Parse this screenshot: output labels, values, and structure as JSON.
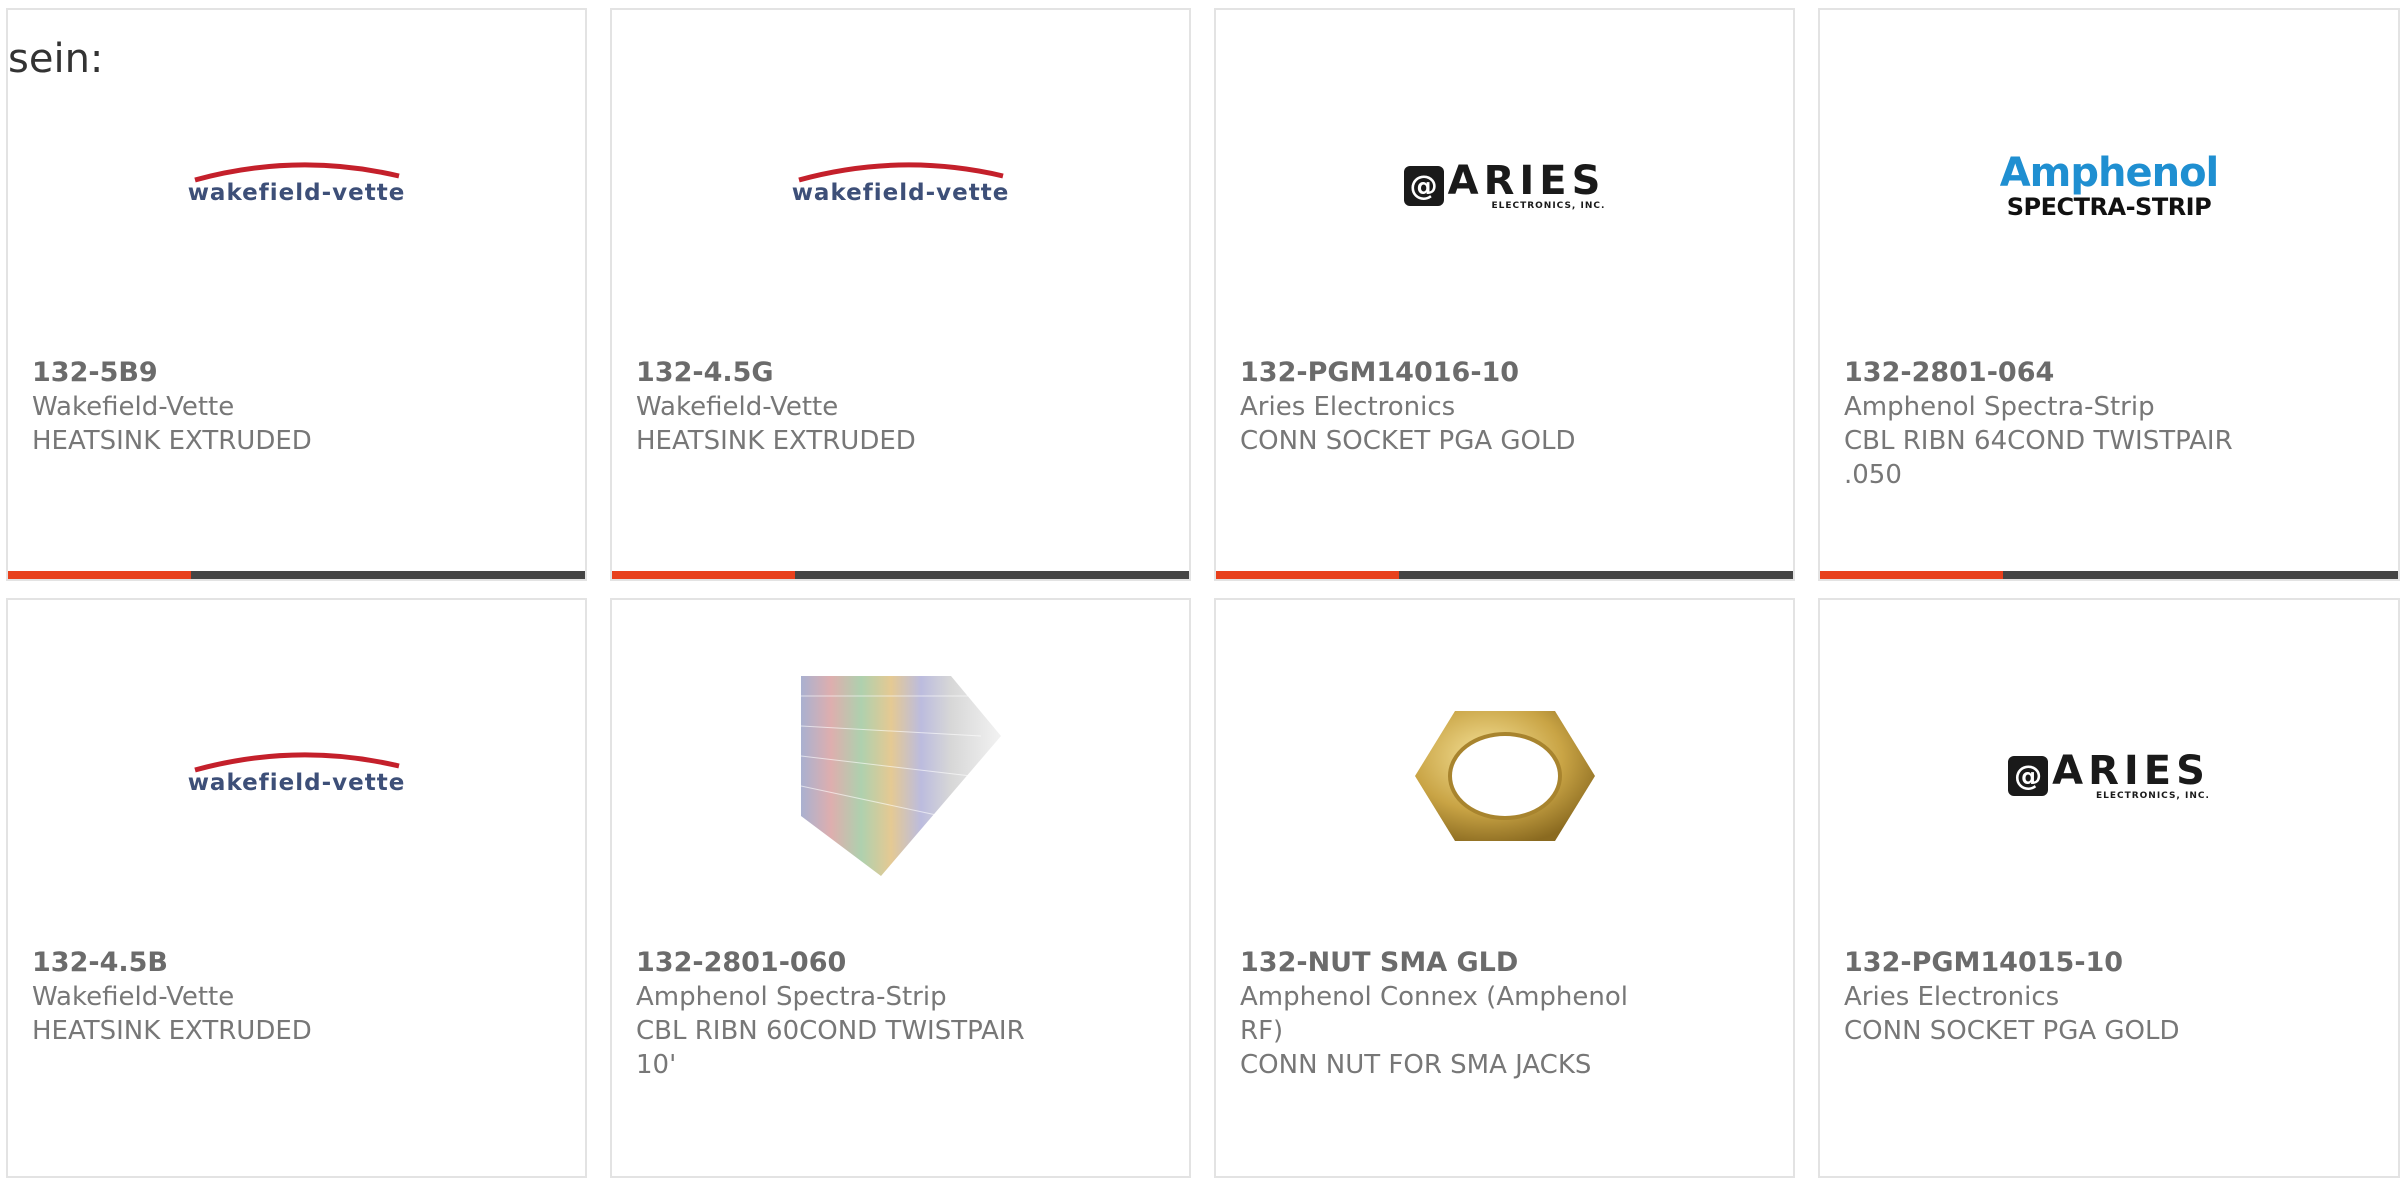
{
  "intro_text": "sein:",
  "colors": {
    "accent": "#e8401c",
    "bar": "#444444",
    "border": "#e3e3e3",
    "text": "#777777"
  },
  "products": [
    {
      "part_number": "132-5B9",
      "manufacturer": "Wakefield-Vette",
      "description": "HEATSINK EXTRUDED",
      "image": "wakefield-vette-logo",
      "logo_text": "wakefield-vette"
    },
    {
      "part_number": "132-4.5G",
      "manufacturer": "Wakefield-Vette",
      "description": "HEATSINK EXTRUDED",
      "image": "wakefield-vette-logo",
      "logo_text": "wakefield-vette"
    },
    {
      "part_number": "132-PGM14016-10",
      "manufacturer": "Aries Electronics",
      "description": "CONN SOCKET PGA GOLD",
      "image": "aries-logo",
      "logo_text": "ARIES",
      "logo_sub": "ELECTRONICS, INC."
    },
    {
      "part_number": "132-2801-064",
      "manufacturer": "Amphenol Spectra-Strip",
      "description": "CBL RIBN 64COND TWISTPAIR .050",
      "image": "amphenol-logo",
      "logo_text": "Amphenol",
      "logo_sub": "SPECTRA-STRIP"
    },
    {
      "part_number": "132-4.5B",
      "manufacturer": "Wakefield-Vette",
      "description": "HEATSINK EXTRUDED",
      "image": "wakefield-vette-logo",
      "logo_text": "wakefield-vette"
    },
    {
      "part_number": "132-2801-060",
      "manufacturer": "Amphenol Spectra-Strip",
      "description": "CBL RIBN 60COND TWISTPAIR 10'",
      "image": "ribbon-cable-photo"
    },
    {
      "part_number": "132-NUT SMA GLD",
      "manufacturer": "Amphenol Connex (Amphenol RF)",
      "description": "CONN NUT FOR SMA JACKS",
      "image": "hex-nut-photo"
    },
    {
      "part_number": "132-PGM14015-10",
      "manufacturer": "Aries Electronics",
      "description": "CONN SOCKET PGA GOLD",
      "image": "aries-logo",
      "logo_text": "ARIES",
      "logo_sub": "ELECTRONICS, INC."
    }
  ]
}
